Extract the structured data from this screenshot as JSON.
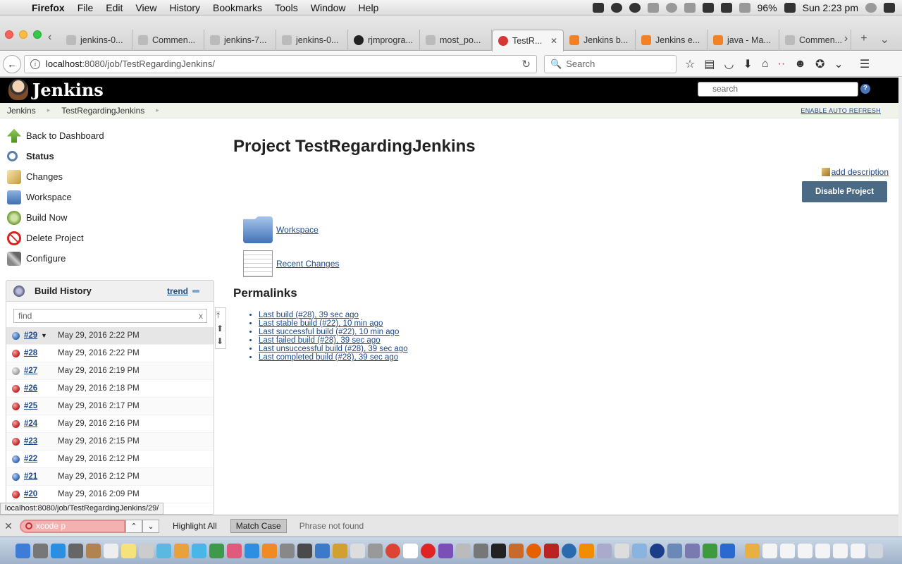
{
  "menubar": {
    "app": "Firefox",
    "items": [
      "File",
      "Edit",
      "View",
      "History",
      "Bookmarks",
      "Tools",
      "Window",
      "Help"
    ],
    "battery": "96%",
    "clock": "Sun 2:23 pm"
  },
  "tabs": [
    {
      "label": "jenkins-0...",
      "favicon": "generic"
    },
    {
      "label": "Commen...",
      "favicon": "generic"
    },
    {
      "label": "jenkins-7...",
      "favicon": "generic"
    },
    {
      "label": "jenkins-0...",
      "favicon": "generic"
    },
    {
      "label": "rjmprogra...",
      "favicon": "github"
    },
    {
      "label": "most_po...",
      "favicon": "generic"
    },
    {
      "label": "TestR...",
      "favicon": "jenkins",
      "active": true
    },
    {
      "label": "Jenkins b...",
      "favicon": "stackoverflow"
    },
    {
      "label": "Jenkins e...",
      "favicon": "stackoverflow"
    },
    {
      "label": "java - Ma...",
      "favicon": "stackoverflow"
    },
    {
      "label": "Commen...",
      "favicon": "generic"
    }
  ],
  "navbar": {
    "url_host": "localhost",
    "url_path": ":8080/job/TestRegardingJenkins/",
    "search_placeholder": "Search"
  },
  "jenkins": {
    "brand": "Jenkins",
    "search_placeholder": "search",
    "help": "?",
    "breadcrumbs": [
      "Jenkins",
      "TestRegardingJenkins"
    ],
    "auto_refresh": "ENABLE AUTO REFRESH",
    "tasks": [
      {
        "label": "Back to Dashboard",
        "icon": "up-arrow-icon"
      },
      {
        "label": "Status",
        "icon": "magnifier-icon",
        "bold": true
      },
      {
        "label": "Changes",
        "icon": "notepad-icon"
      },
      {
        "label": "Workspace",
        "icon": "folder-icon"
      },
      {
        "label": "Build Now",
        "icon": "build-clock-icon"
      },
      {
        "label": "Delete Project",
        "icon": "no-entry-icon"
      },
      {
        "label": "Configure",
        "icon": "wrench-icon"
      }
    ],
    "build_history": {
      "title": "Build History",
      "trend": "trend",
      "find_placeholder": "find",
      "clear": "x",
      "builds": [
        {
          "num": "#29",
          "date": "May 29, 2016 2:22 PM",
          "status": "blue",
          "menu": true
        },
        {
          "num": "#28",
          "date": "May 29, 2016 2:22 PM",
          "status": "red"
        },
        {
          "num": "#27",
          "date": "May 29, 2016 2:19 PM",
          "status": "grey"
        },
        {
          "num": "#26",
          "date": "May 29, 2016 2:18 PM",
          "status": "red"
        },
        {
          "num": "#25",
          "date": "May 29, 2016 2:17 PM",
          "status": "red"
        },
        {
          "num": "#24",
          "date": "May 29, 2016 2:16 PM",
          "status": "red"
        },
        {
          "num": "#23",
          "date": "May 29, 2016 2:15 PM",
          "status": "red"
        },
        {
          "num": "#22",
          "date": "May 29, 2016 2:12 PM",
          "status": "blue"
        },
        {
          "num": "#21",
          "date": "May 29, 2016 2:12 PM",
          "status": "blue"
        },
        {
          "num": "#20",
          "date": "May 29, 2016 2:09 PM",
          "status": "red"
        }
      ]
    },
    "main": {
      "title": "Project TestRegardingJenkins",
      "add_description": "add description",
      "disable_button": "Disable Project",
      "links": [
        {
          "label": "Workspace",
          "icon": "folder-icon"
        },
        {
          "label": "Recent Changes",
          "icon": "notepad-icon"
        }
      ],
      "permalinks_title": "Permalinks",
      "permalinks": [
        "Last build (#28), 39 sec ago",
        "Last stable build (#22), 10 min ago",
        "Last successful build (#22), 10 min ago",
        "Last failed build (#28), 39 sec ago",
        "Last unsuccessful build (#28), 39 sec ago",
        "Last completed build (#28), 39 sec ago"
      ]
    }
  },
  "status_url": "localhost:8080/job/TestRegardingJenkins/29/",
  "findbar": {
    "value": "xcode p",
    "highlight_all": "Highlight All",
    "match_case": "Match Case",
    "status": "Phrase not found"
  },
  "colors": {
    "jenkins_header": "#000000",
    "link": "#204a87",
    "disable_button": "#4b6a85",
    "find_not_found": "#f4b1b1"
  }
}
